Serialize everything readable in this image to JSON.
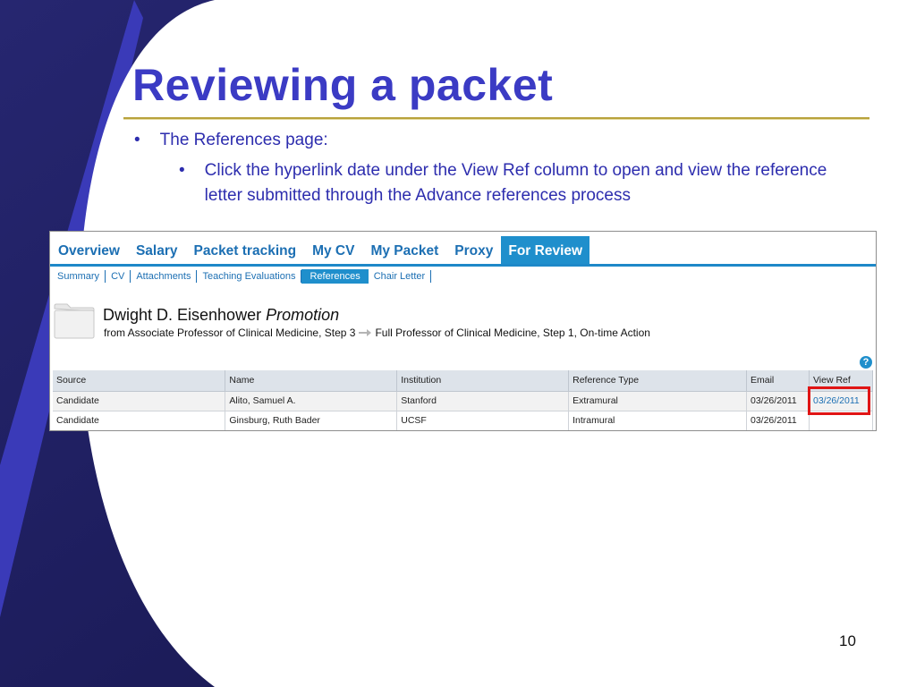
{
  "slide": {
    "title": "Reviewing a packet",
    "bullet_marker": "•",
    "bullet1": "The References page:",
    "bullet2": "Click the hyperlink date under the View Ref column to open and view the reference letter submitted through the Advance references process",
    "page_number": "10"
  },
  "app": {
    "tabs": [
      {
        "label": "Overview"
      },
      {
        "label": "Salary"
      },
      {
        "label": "Packet tracking"
      },
      {
        "label": "My CV"
      },
      {
        "label": "My Packet"
      },
      {
        "label": "Proxy"
      },
      {
        "label": "For Review",
        "active": true
      }
    ],
    "subtabs": [
      {
        "label": "Summary"
      },
      {
        "label": "CV"
      },
      {
        "label": "Attachments"
      },
      {
        "label": "Teaching Evaluations"
      },
      {
        "label": "References",
        "active": true
      },
      {
        "label": "Chair Letter"
      }
    ],
    "person": {
      "name": "Dwight D. Eisenhower",
      "action": "Promotion",
      "from": "from Associate Professor of Clinical Medicine, Step 3",
      "to": "Full Professor of Clinical Medicine, Step 1, On-time Action"
    },
    "help_icon": "?",
    "table": {
      "headers": [
        "Source",
        "Name",
        "Institution",
        "Reference Type",
        "Email",
        "View Ref"
      ],
      "rows": [
        [
          "Candidate",
          "Alito, Samuel A.",
          "Stanford",
          "Extramural",
          "03/26/2011",
          "03/26/2011"
        ],
        [
          "Candidate",
          "Ginsburg, Ruth Bader",
          "UCSF",
          "Intramural",
          "03/26/2011",
          ""
        ]
      ]
    }
  },
  "colors": {
    "title": "#3b3bc4",
    "tab_text": "#1c6fb3",
    "tab_active_bg": "#1f8fcc",
    "highlight": "#e01515",
    "background_dark": "#1f1f5c",
    "background_accent": "#3a3ab8"
  },
  "icons": [
    "folder-icon",
    "arrow-right-icon",
    "help-icon"
  ]
}
